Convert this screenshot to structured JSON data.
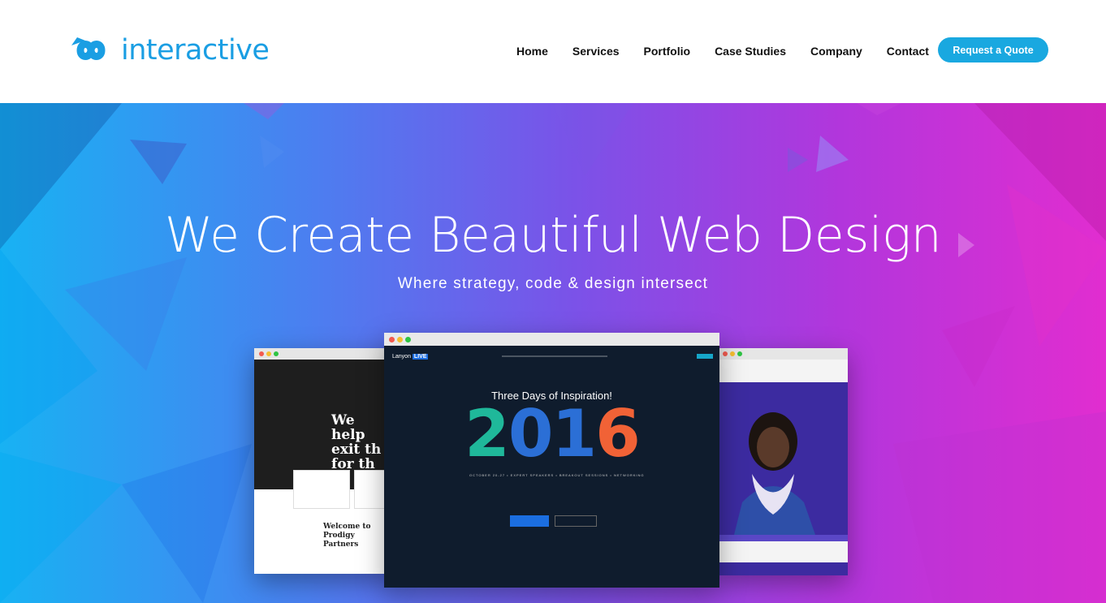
{
  "brand": {
    "name": "interactive",
    "primary_color": "#1a9ee3",
    "icon": "infinity-logo-icon"
  },
  "nav": {
    "items": [
      {
        "label": "Home"
      },
      {
        "label": "Services"
      },
      {
        "label": "Portfolio"
      },
      {
        "label": "Case Studies"
      },
      {
        "label": "Company"
      },
      {
        "label": "Contact"
      }
    ],
    "cta_label": "Request a Quote",
    "cta_color": "#19a8e0"
  },
  "hero": {
    "title": "We Create Beautiful Web Design",
    "subtitle": "Where strategy, code & design intersect",
    "gradient_colors": [
      "#18b2f3",
      "#7b52e8",
      "#e12dd0"
    ]
  },
  "showcase": {
    "left": {
      "headline": "We help exit th for th",
      "welcome": "Welcome to Prodigy Partners"
    },
    "center": {
      "logo_text": "Lanyon",
      "logo_badge": "LIVE",
      "tagline": "Three Days of Inspiration!",
      "year_digits": [
        "2",
        "0",
        "1",
        "6"
      ],
      "meta": "OCTOBER 20-27  •  EXPERT SPEAKERS  •  BREAKOUT SESSIONS  •  NETWORKING"
    },
    "right": {
      "description": "portfolio mockup with portrait"
    }
  }
}
